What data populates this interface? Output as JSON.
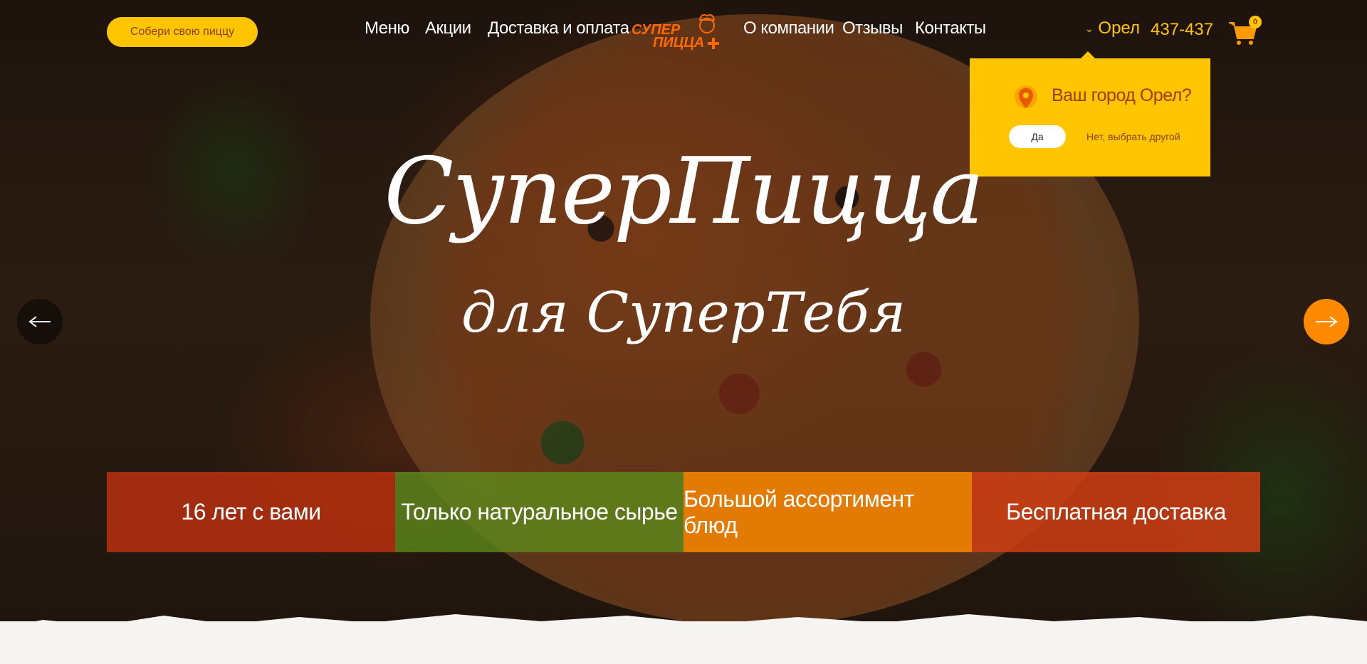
{
  "header": {
    "build_button": "Собери свою пиццу",
    "nav_left": [
      "Меню",
      "Акции",
      "Доставка и оплата"
    ],
    "nav_right": [
      "О компании",
      "Отзывы",
      "Контакты"
    ],
    "logo_line1": "СУПЕР",
    "logo_line2": "ПИЦЦА",
    "city": "Орел",
    "phone": "437-437",
    "cart_count": "0"
  },
  "city_popup": {
    "question": "Ваш город Орел?",
    "yes": "Да",
    "no": "Нет, выбрать другой"
  },
  "hero": {
    "title": "СуперПицца",
    "subtitle": "для СуперТебя"
  },
  "features": [
    {
      "text": "16 лет с вами",
      "color": "#b8300f"
    },
    {
      "text": "Только натуральное сырье",
      "color": "#5e8a1c"
    },
    {
      "text": "Большой ассортимент блюд",
      "color": "#ff8a00"
    },
    {
      "text": "Бесплатная доставка",
      "color": "#cf3e14"
    }
  ],
  "colors": {
    "accent": "#ffc600",
    "orange": "#ff8a00"
  }
}
